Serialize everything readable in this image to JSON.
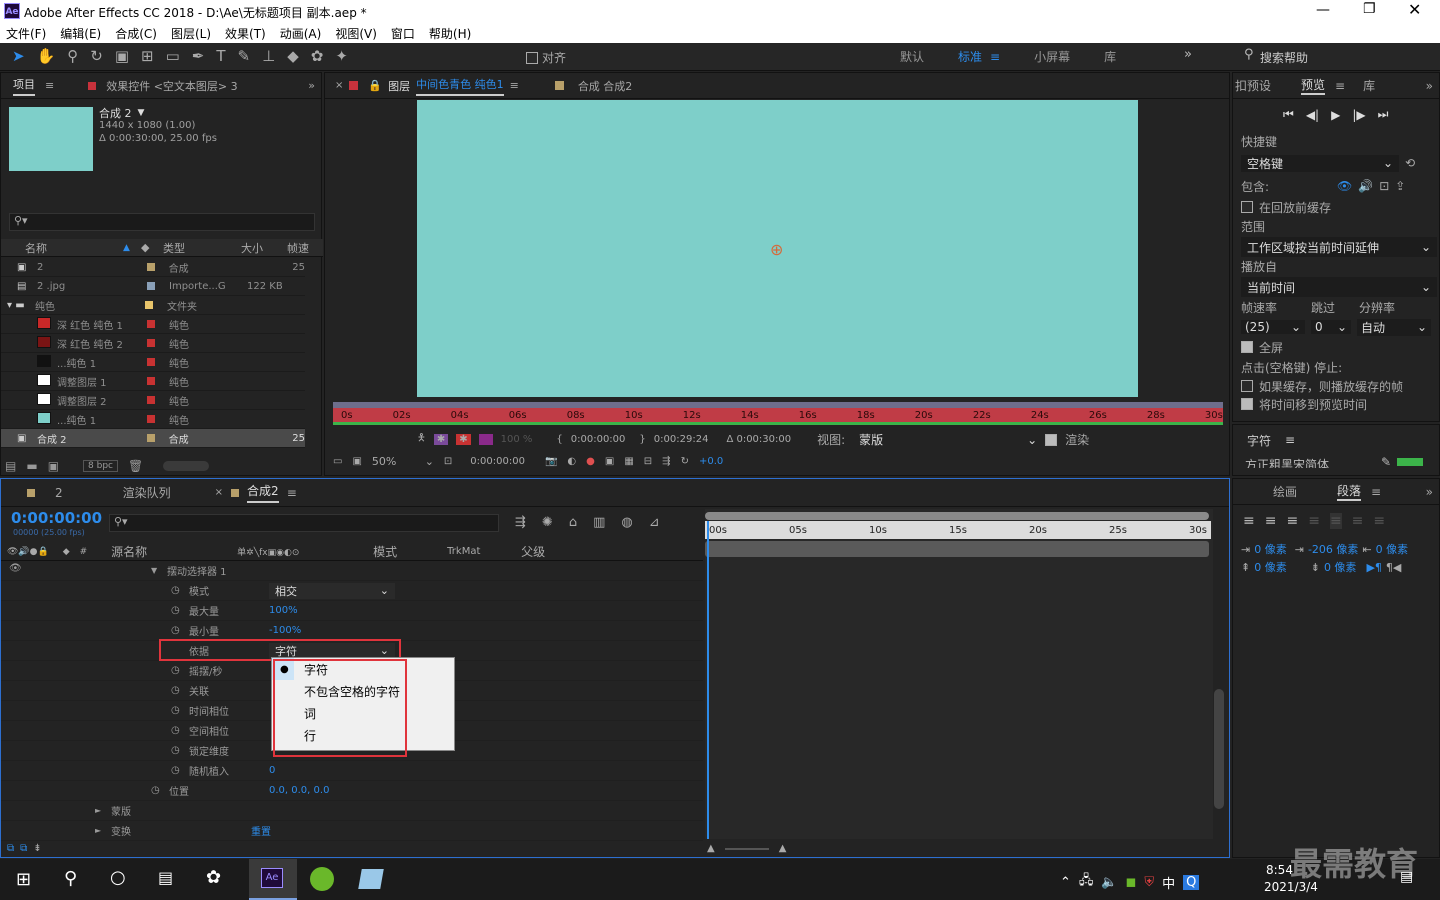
{
  "window": {
    "title": "Adobe After Effects CC 2018 - D:\\Ae\\无标题项目 副本.aep *",
    "app_icon": "Ae"
  },
  "menu": [
    "文件(F)",
    "编辑(E)",
    "合成(C)",
    "图层(L)",
    "效果(T)",
    "动画(A)",
    "视图(V)",
    "窗口",
    "帮助(H)"
  ],
  "toolbar": {
    "snap_label": "对齐",
    "workspaces": [
      "默认",
      "标准",
      "小屏幕",
      "库"
    ],
    "active_workspace": "标准",
    "search_placeholder": "搜索帮助"
  },
  "project": {
    "tab": "项目",
    "effects_tab": "效果控件 <空文本图层> 3",
    "comp_name": "合成 2",
    "comp_size": "1440 x 1080 (1.00)",
    "comp_duration": "Δ 0:00:30:00, 25.00 fps",
    "columns": [
      "名称",
      "类型",
      "大小",
      "帧速"
    ],
    "rows": [
      {
        "name": "2",
        "type": "合成",
        "size": "",
        "fps": "25",
        "swatch": "#b8a06a",
        "icon": "comp"
      },
      {
        "name": "2 .jpg",
        "type": "Importe...G",
        "size": "122 KB",
        "fps": "",
        "swatch": "#8aa0b8",
        "icon": "file"
      },
      {
        "name": "纯色",
        "type": "文件夹",
        "size": "",
        "fps": "",
        "swatch": "#e8c46a",
        "icon": "folder"
      },
      {
        "name": "深 红色 纯色 1",
        "type": "纯色",
        "size": "",
        "fps": "",
        "swatch": "#c83232",
        "thumb": "#c82828"
      },
      {
        "name": "深 红色 纯色 2",
        "type": "纯色",
        "size": "",
        "fps": "",
        "swatch": "#c83232",
        "thumb": "#7a1414"
      },
      {
        "name": "...纯色 1",
        "type": "纯色",
        "size": "",
        "fps": "",
        "swatch": "#c83232",
        "thumb": "#111111"
      },
      {
        "name": "调整图层 1",
        "type": "纯色",
        "size": "",
        "fps": "",
        "swatch": "#c83232",
        "thumb": "#ffffff"
      },
      {
        "name": "调整图层 2",
        "type": "纯色",
        "size": "",
        "fps": "",
        "swatch": "#c83232",
        "thumb": "#ffffff"
      },
      {
        "name": "...纯色 1",
        "type": "纯色",
        "size": "",
        "fps": "",
        "swatch": "#c83232",
        "thumb": "#7ecfc9"
      },
      {
        "name": "合成 2",
        "type": "合成",
        "size": "",
        "fps": "25",
        "swatch": "#b8a06a",
        "icon": "comp",
        "selected": true
      }
    ],
    "bpc": "8 bpc"
  },
  "viewer": {
    "layer_tab": "图层",
    "layer_name": "中间色青色 纯色1",
    "comp_tab": "合成 合成2",
    "canvas_color": "#7ecfc9",
    "ruler": [
      "0s",
      "02s",
      "04s",
      "06s",
      "08s",
      "10s",
      "12s",
      "14s",
      "16s",
      "18s",
      "20s",
      "22s",
      "24s",
      "26s",
      "28s",
      "30s"
    ],
    "in_time": "0:00:00:00",
    "out_time": "0:00:29:24",
    "duration": "Δ 0:00:30:00",
    "view_label": "视图:",
    "view_value": "蒙版",
    "render_label": "渲染",
    "zoom": "50%",
    "current_time": "0:00:00:00",
    "exposure": "+0.0",
    "opacity_disabled": "100 %"
  },
  "preview": {
    "tab_presets": "扣预设",
    "tab_preview": "预览",
    "tab_lib": "库",
    "shortcut_label": "快捷键",
    "shortcut_value": "空格键",
    "include_label": "包含:",
    "cache_label": "在回放前缓存",
    "range_label": "范围",
    "range_value": "工作区域按当前时间延伸",
    "play_from_label": "播放自",
    "play_from_value": "当前时间",
    "fps_label": "帧速率",
    "skip_label": "跳过",
    "res_label": "分辨率",
    "fps_value": "(25)",
    "skip_value": "0",
    "res_value": "自动",
    "fullscreen_label": "全屏",
    "stop_label": "点击(空格键) 停止:",
    "if_cache_label": "如果缓存，则播放缓存的帧",
    "move_time_label": "将时间移到预览时间"
  },
  "character": {
    "tab": "字符",
    "font_value": "方正粗黑宋简体"
  },
  "paragraph": {
    "tab_draw": "绘画",
    "tab_para": "段落",
    "indent1": "0 像素",
    "indent2": "-206 像素",
    "indent3": "0 像素",
    "indent4": "0 像素",
    "indent5": "0 像素"
  },
  "timeline": {
    "tab_2": "2",
    "tab_render": "渲染队列",
    "tab_comp": "合成2",
    "timecode": "0:00:00:00",
    "timecode_sub": "00000 (25.00 fps)",
    "col_name": "源名称",
    "col_mode": "模式",
    "col_trk": "TrkMat",
    "col_parent": "父级",
    "ruler": [
      "00s",
      "05s",
      "10s",
      "15s",
      "20s",
      "25s",
      "30s"
    ],
    "rows": [
      {
        "label": "摆动选择器 1",
        "value": "",
        "indent": 1,
        "twirl": true
      },
      {
        "label": "模式",
        "value": "相交",
        "indent": 2,
        "stopwatch": true,
        "dropdown": true
      },
      {
        "label": "最大量",
        "value": "100%",
        "indent": 2,
        "stopwatch": true
      },
      {
        "label": "最小量",
        "value": "-100%",
        "indent": 2,
        "stopwatch": true
      },
      {
        "label": "依据",
        "value": "字符",
        "indent": 2,
        "dropdown": true,
        "highlight": true
      },
      {
        "label": "摇摆/秒",
        "value": "",
        "indent": 2,
        "stopwatch": true
      },
      {
        "label": "关联",
        "value": "",
        "indent": 2,
        "stopwatch": true
      },
      {
        "label": "时间相位",
        "value": "",
        "indent": 2,
        "stopwatch": true
      },
      {
        "label": "空间相位",
        "value": "",
        "indent": 2,
        "stopwatch": true
      },
      {
        "label": "锁定维度",
        "value": "",
        "indent": 2,
        "stopwatch": true
      },
      {
        "label": "随机植入",
        "value": "0",
        "indent": 2,
        "stopwatch": true
      },
      {
        "label": "位置",
        "value": "0.0, 0.0, 0.0",
        "indent": 1,
        "stopwatch": true
      },
      {
        "label": "蒙版",
        "value": "",
        "indent": 0,
        "twirl": true
      },
      {
        "label": "变换",
        "value": "重置",
        "indent": 0,
        "twirl": true
      }
    ],
    "dropdown_options": [
      "字符",
      "不包含空格的字符",
      "词",
      "行"
    ],
    "dropdown_selected": "字符"
  },
  "taskbar": {
    "time": "8:54",
    "date": "2021/3/4",
    "ime": "中",
    "watermark": "最需教育"
  }
}
